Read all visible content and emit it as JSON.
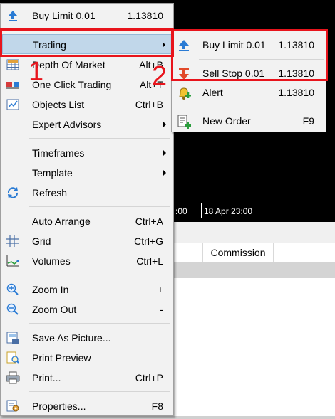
{
  "background": {
    "time_axis_left": ":00",
    "time_axis_right": "18 Apr 23:00",
    "commission_header": "Commission"
  },
  "main_menu": {
    "items": [
      {
        "label": "Buy Limit 0.01",
        "shortcut": "1.13810",
        "icon": "buy-limit-arrow-up-icon"
      },
      {
        "label": "Trading",
        "shortcut": "",
        "icon": "",
        "submenu": true
      },
      {
        "label": "Depth Of Market",
        "shortcut": "Alt+B",
        "icon": "depth-of-market-icon"
      },
      {
        "label": "One Click Trading",
        "shortcut": "Alt+T",
        "icon": "one-click-trading-icon"
      },
      {
        "label": "Objects List",
        "shortcut": "Ctrl+B",
        "icon": "objects-list-icon"
      },
      {
        "label": "Expert Advisors",
        "shortcut": "",
        "icon": "",
        "submenu": true
      },
      {
        "label": "Timeframes",
        "shortcut": "",
        "icon": "",
        "submenu": true
      },
      {
        "label": "Template",
        "shortcut": "",
        "icon": "",
        "submenu": true
      },
      {
        "label": "Refresh",
        "shortcut": "",
        "icon": "refresh-icon"
      },
      {
        "label": "Auto Arrange",
        "shortcut": "Ctrl+A",
        "icon": ""
      },
      {
        "label": "Grid",
        "shortcut": "Ctrl+G",
        "icon": "grid-icon"
      },
      {
        "label": "Volumes",
        "shortcut": "Ctrl+L",
        "icon": "volumes-icon"
      },
      {
        "label": "Zoom In",
        "shortcut": "+",
        "icon": "zoom-in-icon"
      },
      {
        "label": "Zoom Out",
        "shortcut": "-",
        "icon": "zoom-out-icon"
      },
      {
        "label": "Save As Picture...",
        "shortcut": "",
        "icon": "save-picture-icon"
      },
      {
        "label": "Print Preview",
        "shortcut": "",
        "icon": "print-preview-icon"
      },
      {
        "label": "Print...",
        "shortcut": "Ctrl+P",
        "icon": "printer-icon"
      },
      {
        "label": "Properties...",
        "shortcut": "F8",
        "icon": "properties-icon"
      }
    ]
  },
  "sub_menu": {
    "items": [
      {
        "label": "Buy Limit 0.01",
        "shortcut": "1.13810",
        "icon": "buy-limit-arrow-up-icon"
      },
      {
        "label": "Sell Stop 0.01",
        "shortcut": "1.13810",
        "icon": "sell-stop-arrow-down-icon"
      },
      {
        "label": "Alert",
        "shortcut": "1.13810",
        "icon": "alert-bell-icon"
      },
      {
        "label": "New Order",
        "shortcut": "F9",
        "icon": "new-order-icon"
      }
    ]
  },
  "annotations": {
    "step1": "1",
    "step2": "2"
  },
  "colors": {
    "annotation_red": "#e8141c",
    "highlight": "#c1d7ea",
    "menu_bg": "#f2f2f2"
  }
}
